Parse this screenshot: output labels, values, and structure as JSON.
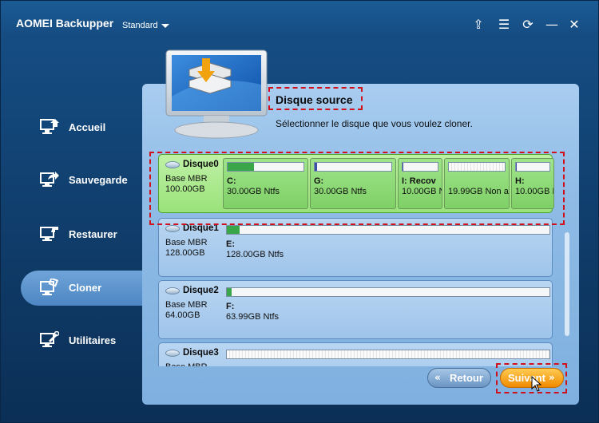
{
  "app": {
    "title": "AOMEI Backupper",
    "edition": "Standard"
  },
  "titlebar_buttons": [
    {
      "name": "upgrade-icon",
      "glyph": "⇪"
    },
    {
      "name": "menu-icon",
      "glyph": "☰"
    },
    {
      "name": "refresh-icon",
      "glyph": "⟳"
    },
    {
      "name": "minimize-icon",
      "glyph": "—"
    },
    {
      "name": "close-icon",
      "glyph": "✕"
    }
  ],
  "nav": {
    "items": [
      {
        "label": "Accueil",
        "icon": "home-monitor-icon"
      },
      {
        "label": "Sauvegarde",
        "icon": "backup-monitor-icon"
      },
      {
        "label": "Restaurer",
        "icon": "restore-monitor-icon"
      },
      {
        "label": "Cloner",
        "icon": "clone-monitor-icon",
        "active": true
      },
      {
        "label": "Utilitaires",
        "icon": "tools-monitor-icon"
      }
    ]
  },
  "main": {
    "heading": "Disque source",
    "subtitle": "Sélectionner le disque que vous voulez cloner.",
    "disks": [
      {
        "name": "Disque0",
        "type": "Base MBR",
        "size": "100.00GB",
        "selected": true,
        "partitions": [
          {
            "letter": "C:",
            "info": "30.00GB Ntfs",
            "used": 0.35,
            "color": "#3aa64a"
          },
          {
            "letter": "G:",
            "info": "30.00GB Ntfs",
            "used": 0.03,
            "color": "#3a4fa6"
          },
          {
            "letter": "I: Recov",
            "info": "10.00GB N",
            "used": 0.02,
            "color": "#3a4fa6"
          },
          {
            "letter": "",
            "info": "19.99GB Non a",
            "used": 0,
            "unallocated": true
          },
          {
            "letter": "H:",
            "info": "10.00GB N",
            "used": 0.03,
            "color": "#3a4fa6"
          }
        ]
      },
      {
        "name": "Disque1",
        "type": "Base MBR",
        "size": "128.00GB",
        "partitions": [
          {
            "letter": "E:",
            "info": "128.00GB Ntfs",
            "used": 0.04,
            "color": "#3aa64a"
          }
        ]
      },
      {
        "name": "Disque2",
        "type": "Base MBR",
        "size": "64.00GB",
        "partitions": [
          {
            "letter": "F:",
            "info": "63.99GB Ntfs",
            "used": 0.01,
            "color": "#3aa64a"
          }
        ]
      },
      {
        "name": "Disque3",
        "type": "Base MBR",
        "size": "",
        "partitions": [
          {
            "letter": "",
            "info": "",
            "used": 0,
            "unallocated": true
          }
        ]
      }
    ]
  },
  "footer": {
    "back_label": "Retour",
    "next_label": "Suivant"
  }
}
